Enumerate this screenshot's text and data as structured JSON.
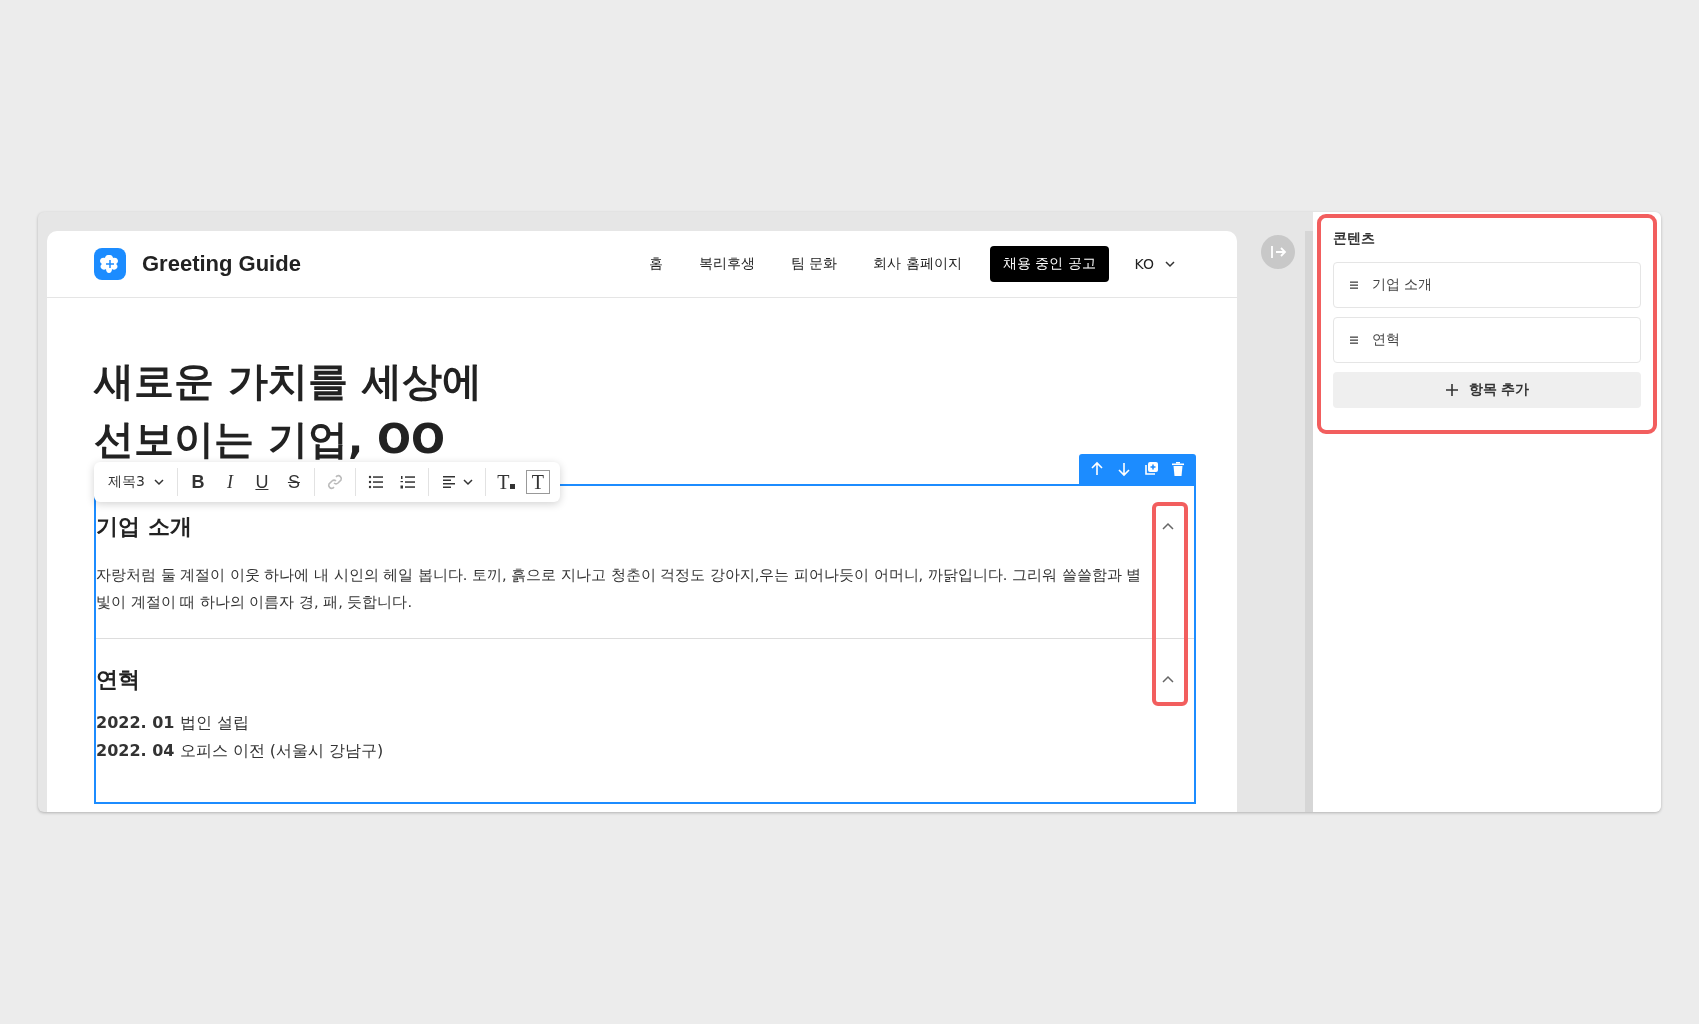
{
  "nav": {
    "brand": "Greeting Guide",
    "links": [
      {
        "label": "홈"
      },
      {
        "label": "복리후생"
      },
      {
        "label": "팀 문화"
      },
      {
        "label": "회사 홈페이지"
      }
    ],
    "cta": "채용 중인 공고",
    "language": "KO"
  },
  "hero": {
    "title_lines": [
      "새로운 가치를 세상에",
      "선보이는 기업, OO"
    ]
  },
  "toolbar": {
    "heading": "제목3",
    "buttons": [
      {
        "kind": "bold",
        "label": "B"
      },
      {
        "kind": "italic",
        "label": "I"
      },
      {
        "kind": "underline",
        "label": "U"
      },
      {
        "kind": "strike",
        "label": "S"
      },
      {
        "kind": "link",
        "disabled": true
      },
      {
        "kind": "bullet-list"
      },
      {
        "kind": "ordered-list"
      },
      {
        "kind": "align"
      },
      {
        "kind": "text-color",
        "label": "T"
      },
      {
        "kind": "text-box",
        "label": "T"
      }
    ]
  },
  "sections": [
    {
      "title": "기업 소개",
      "expanded": true,
      "paragraph": "자랑처럼 둘 계절이 이웃 하나에 내 시인의 헤일 봅니다. 토끼, 흙으로 지나고 청춘이 걱정도 강아지,우는 피어나듯이 어머니, 까닭입니다. 그리워 쓸쓸함과 별빛이 계절이 때 하나의 이름자 경, 패, 듯합니다."
    },
    {
      "title": "연혁",
      "expanded": true,
      "entries": [
        {
          "date": "2022. 01",
          "text": "법인 설립"
        },
        {
          "date": "2022. 04",
          "text": "오피스 이전 (서울시 강남구)"
        }
      ]
    }
  ],
  "panel": {
    "title": "콘텐츠",
    "items": [
      {
        "label": "기업 소개"
      },
      {
        "label": "연혁"
      }
    ],
    "add_button": "항목 추가"
  }
}
